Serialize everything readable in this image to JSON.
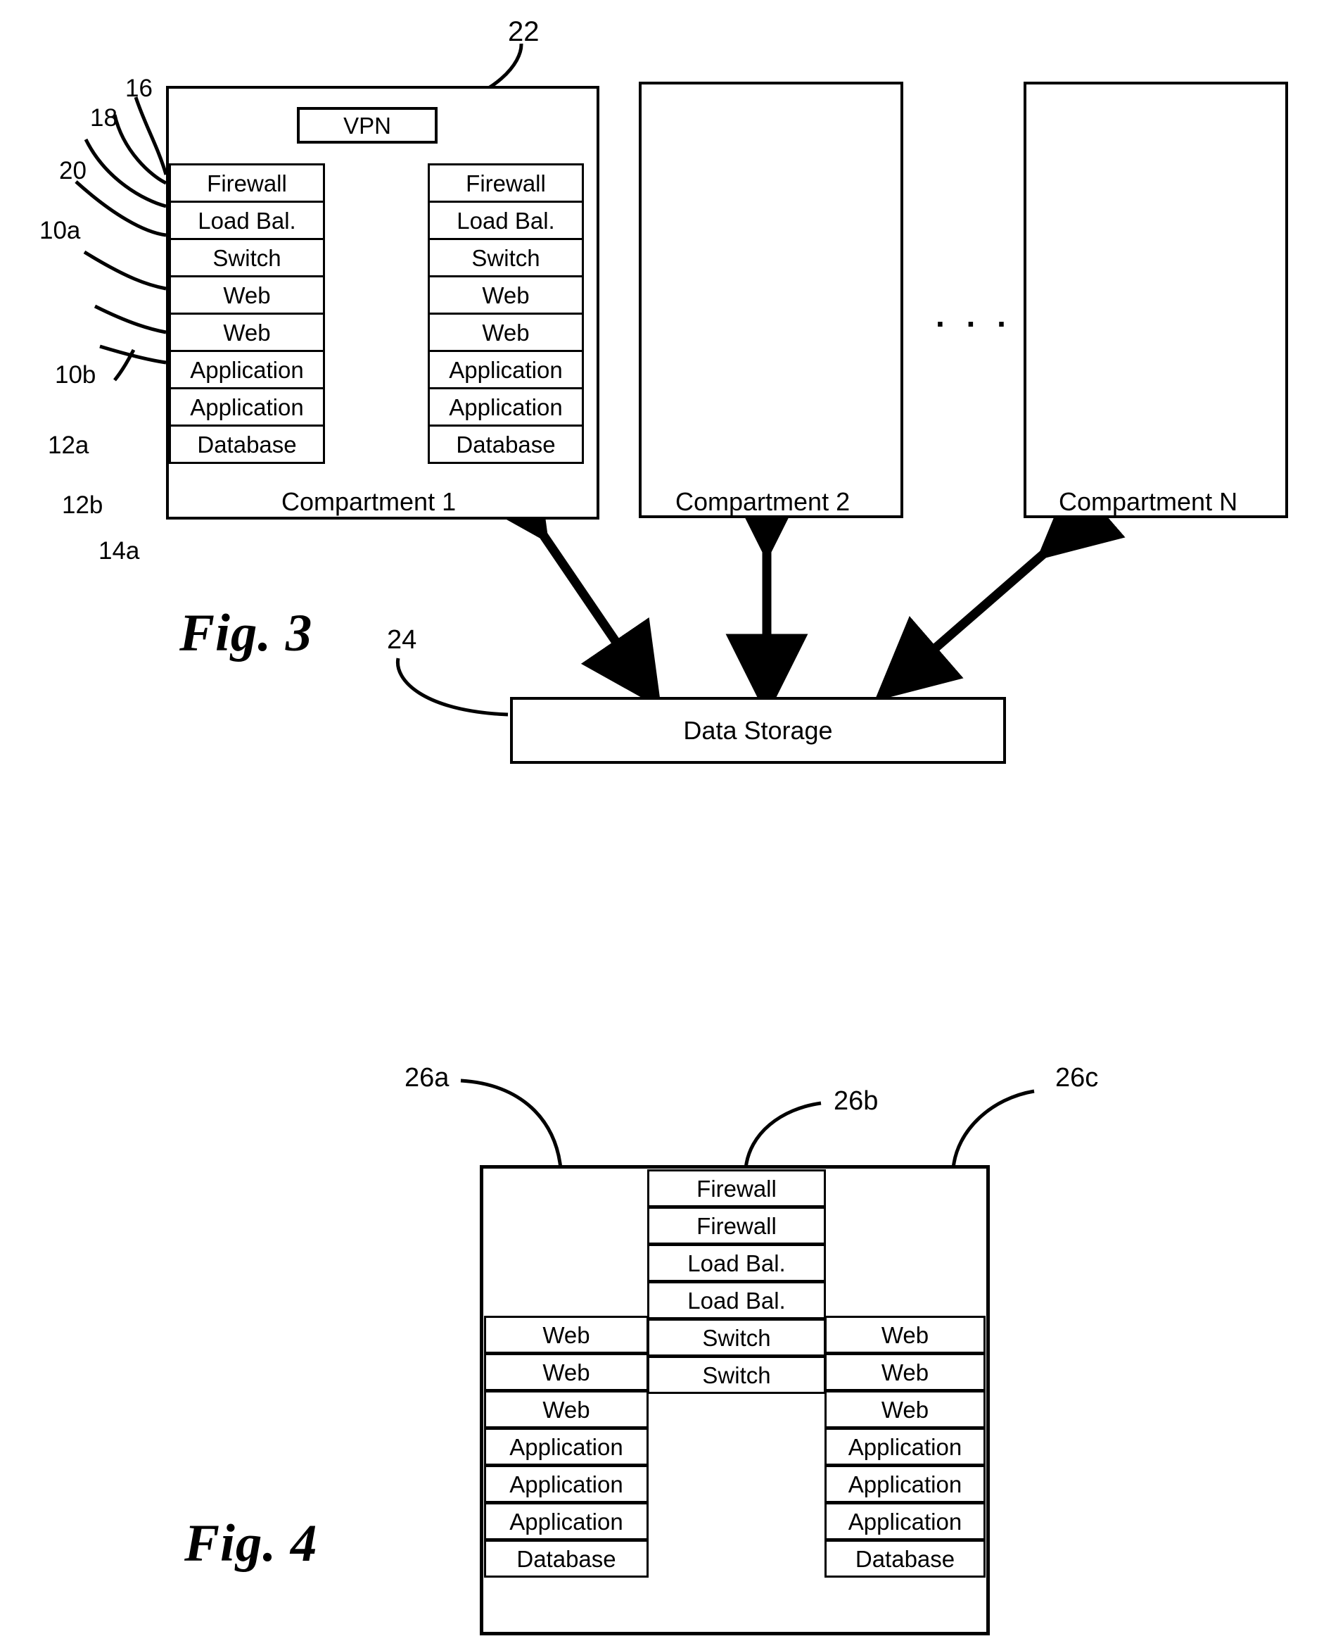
{
  "figures": [
    {
      "id": "fig3",
      "caption": "Fig. 3",
      "vpn": {
        "label": "VPN",
        "ref": "22"
      },
      "compartments": [
        {
          "name": "Compartment 1"
        },
        {
          "name": "Compartment 2"
        },
        {
          "name": "Compartment N"
        }
      ],
      "ellipsis": ". . .",
      "rack_left": {
        "rows": [
          "Firewall",
          "Load Bal.",
          "Switch",
          "Web",
          "Web",
          "Application",
          "Application",
          "Database"
        ]
      },
      "rack_right": {
        "rows": [
          "Firewall",
          "Load Bal.",
          "Switch",
          "Web",
          "Web",
          "Application",
          "Application",
          "Database"
        ]
      },
      "storage": {
        "label": "Data Storage",
        "ref": "24"
      },
      "ref_labels": [
        "16",
        "18",
        "20",
        "10a",
        "10b",
        "12a",
        "12b",
        "14a"
      ]
    },
    {
      "id": "fig4",
      "caption": "Fig. 4",
      "column_refs": [
        "26a",
        "26b",
        "26c"
      ],
      "columns": [
        {
          "ref": "26a",
          "cells": [
            "",
            "",
            "",
            "",
            "Web",
            "Web",
            "Web",
            "Application",
            "Application",
            "Application",
            "Database"
          ]
        },
        {
          "ref": "26b",
          "cells": [
            "Firewall",
            "Firewall",
            "Load Bal.",
            "Load Bal.",
            "Switch",
            "Switch",
            "",
            "",
            "",
            "",
            ""
          ]
        },
        {
          "ref": "26c",
          "cells": [
            "",
            "",
            "",
            "",
            "Web",
            "Web",
            "Web",
            "Application",
            "Application",
            "Application",
            "Database"
          ]
        }
      ]
    }
  ],
  "colors": {
    "line": "#000000",
    "page": "#ffffff"
  }
}
